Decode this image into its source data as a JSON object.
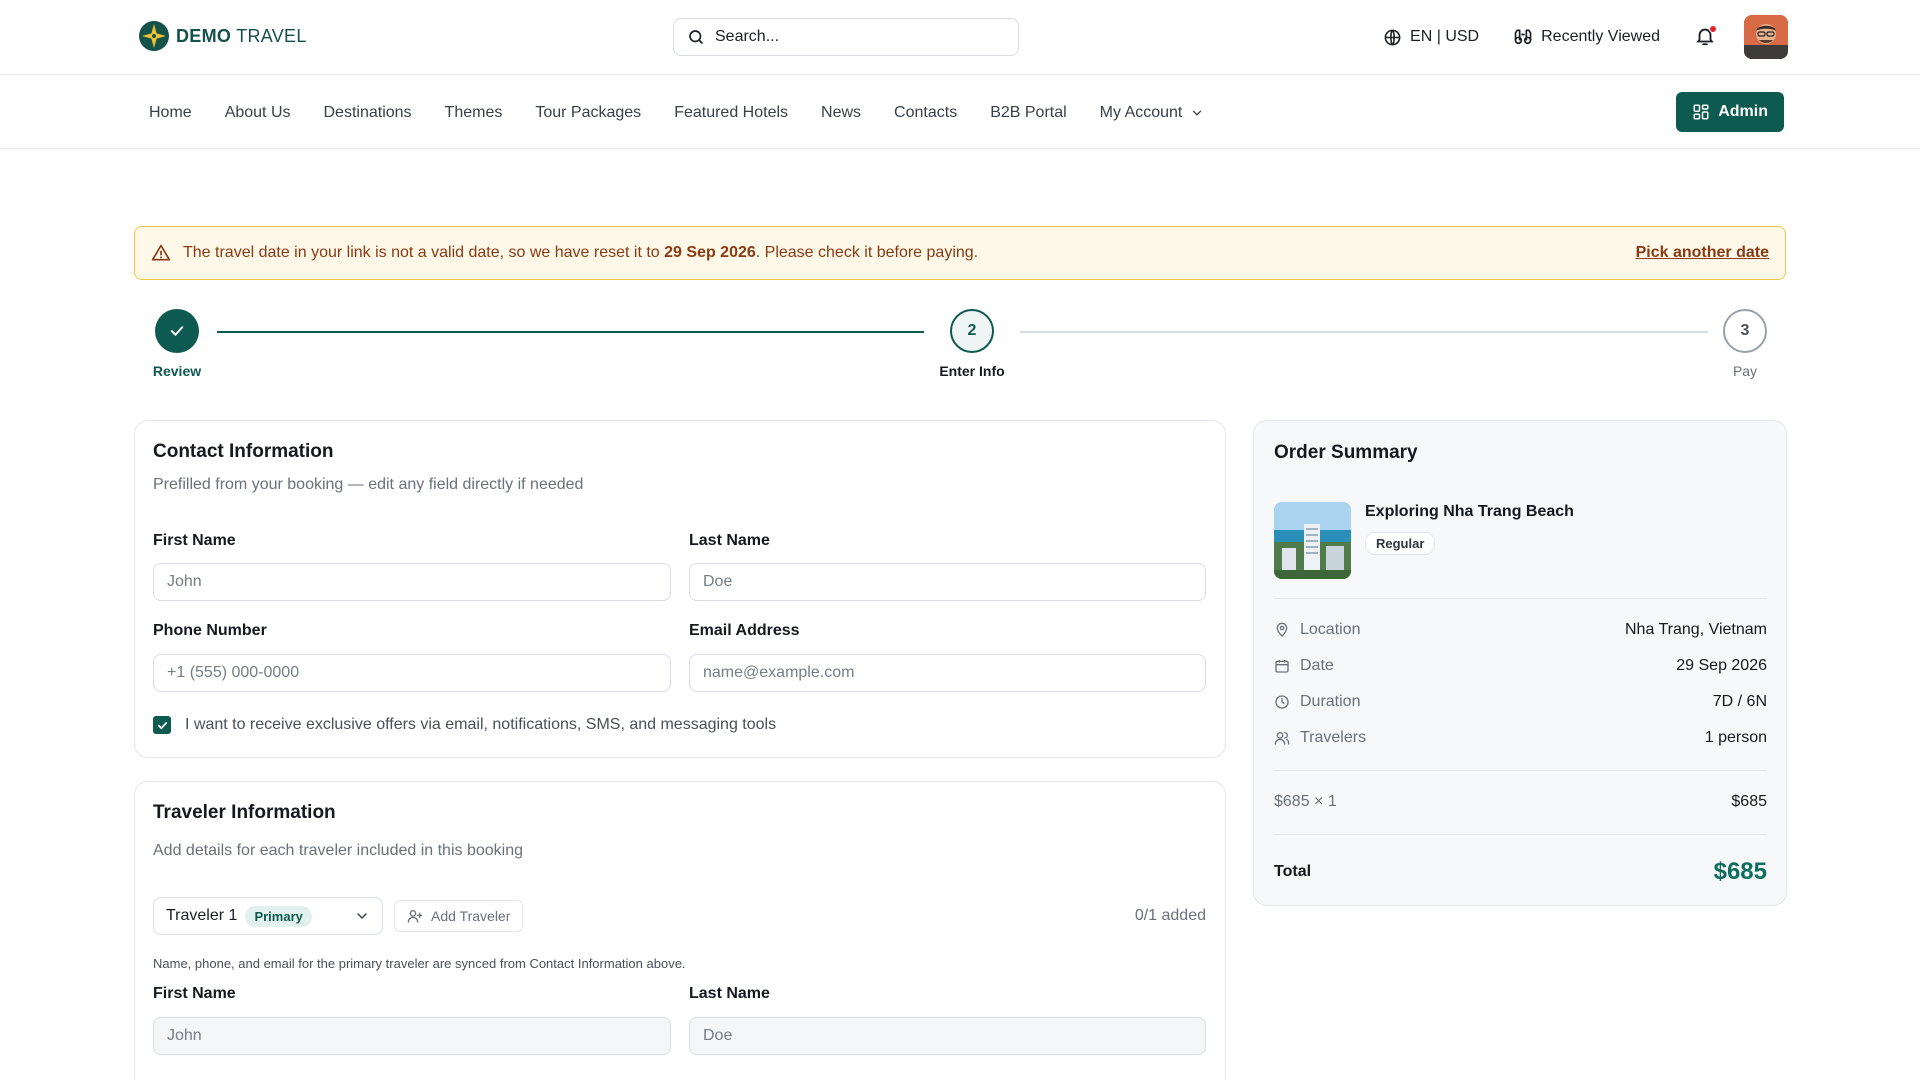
{
  "brand": {
    "name_bold": "DEMO",
    "name_light": "TRAVEL"
  },
  "search": {
    "placeholder": "Search..."
  },
  "topbar": {
    "locale": "EN | USD",
    "recently_viewed": "Recently Viewed"
  },
  "nav": {
    "items": [
      "Home",
      "About Us",
      "Destinations",
      "Themes",
      "Tour Packages",
      "Featured Hotels",
      "News",
      "Contacts",
      "B2B Portal",
      "My Account"
    ],
    "admin_label": "Admin"
  },
  "alert": {
    "text_before": "The travel date in your link is not a valid date, so we have reset it to ",
    "date": "29 Sep 2026",
    "text_after": ". Please check it before paying.",
    "link": "Pick another date"
  },
  "stepper": {
    "steps": [
      {
        "num": "1",
        "label": "Review",
        "state": "done"
      },
      {
        "num": "2",
        "label": "Enter Info",
        "state": "current"
      },
      {
        "num": "3",
        "label": "Pay",
        "state": "upcoming"
      }
    ]
  },
  "contact": {
    "title": "Contact Information",
    "subtitle": "Prefilled from your booking — edit any field directly if needed",
    "first_name_label": "First Name",
    "first_name_placeholder": "John",
    "last_name_label": "Last Name",
    "last_name_placeholder": "Doe",
    "phone_label": "Phone Number",
    "phone_placeholder": "+1 (555) 000-0000",
    "email_label": "Email Address",
    "email_placeholder": "name@example.com",
    "offers_label": "I want to receive exclusive offers via email, notifications, SMS, and messaging tools",
    "offers_checked": true
  },
  "traveler": {
    "title": "Traveler Information",
    "subtitle": "Add details for each traveler included in this booking",
    "selected": "Traveler 1",
    "primary_badge": "Primary",
    "add_label": "Add Traveler",
    "added_count": "0/1 added",
    "sync_note": "Name, phone, and email for the primary traveler are synced from Contact Information above.",
    "first_name_label": "First Name",
    "first_name_placeholder": "John",
    "last_name_label": "Last Name",
    "last_name_placeholder": "Doe"
  },
  "summary": {
    "title": "Order Summary",
    "tour_name": "Exploring Nha Trang Beach",
    "tier": "Regular",
    "rows": [
      {
        "icon": "map-pin-icon",
        "label": "Location",
        "value": "Nha Trang, Vietnam"
      },
      {
        "icon": "calendar-icon",
        "label": "Date",
        "value": "29 Sep 2026"
      },
      {
        "icon": "clock-icon",
        "label": "Duration",
        "value": "7D / 6N"
      },
      {
        "icon": "users-icon",
        "label": "Travelers",
        "value": "1 person"
      }
    ],
    "price_line_label": "$685 × 1",
    "price_line_value": "$685",
    "total_label": "Total",
    "total_value": "$685"
  },
  "colors": {
    "brand": "#0d5a51",
    "accent_total": "#0d6e5f",
    "alert_bg": "#fdf8e7",
    "alert_border": "#f1c84d",
    "alert_text": "#8a3a14"
  }
}
